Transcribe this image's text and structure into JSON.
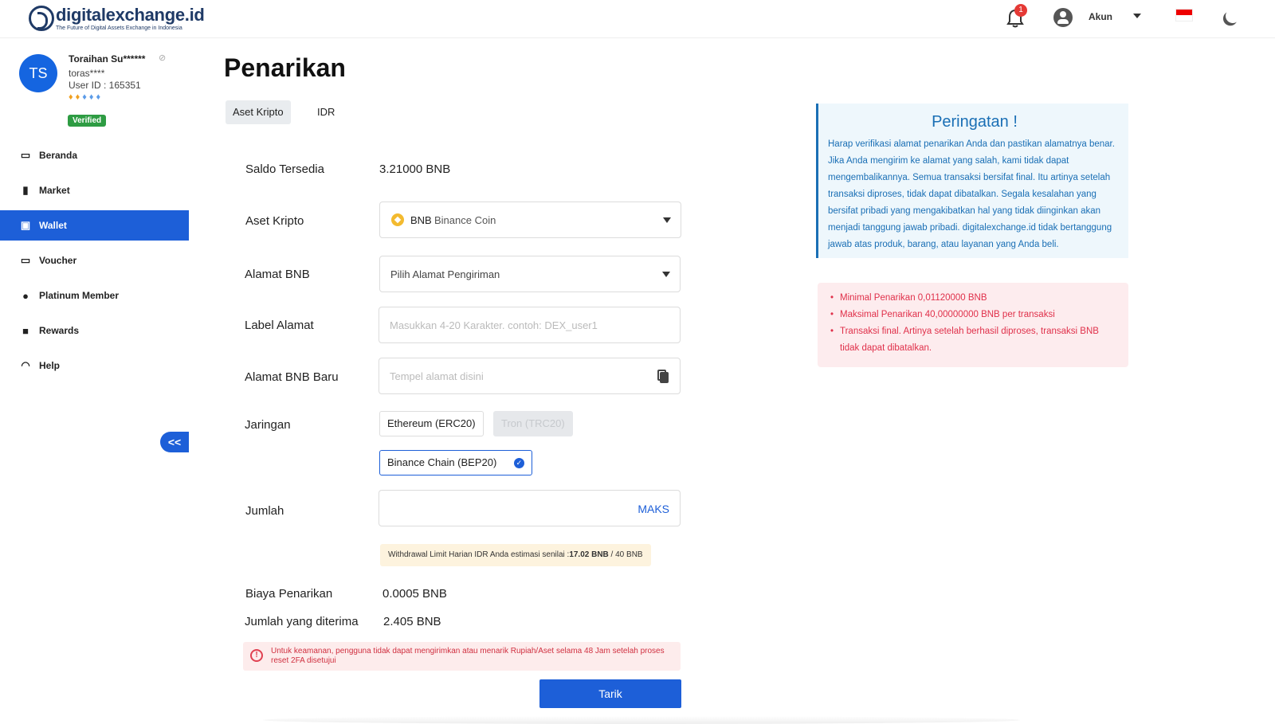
{
  "header": {
    "logo_name": "digitalexchange.id",
    "logo_tagline": "The Future of Digital Assets Exchange in Indonesia",
    "notification_count": "1",
    "account_label": "Akun"
  },
  "sidebar": {
    "avatar_initials": "TS",
    "user_name": "Toraihan Su******",
    "user_handle": "toras****",
    "user_id": "User ID : 165351",
    "verified_label": "Verified",
    "collapse_label": "<<",
    "items": [
      {
        "label": "Beranda",
        "icon": "laptop-icon"
      },
      {
        "label": "Market",
        "icon": "bar-chart-icon"
      },
      {
        "label": "Wallet",
        "icon": "wallet-icon",
        "active": true
      },
      {
        "label": "Voucher",
        "icon": "ticket-icon"
      },
      {
        "label": "Platinum Member",
        "icon": "badge-check-icon"
      },
      {
        "label": "Rewards",
        "icon": "gift-icon"
      },
      {
        "label": "Help",
        "icon": "headset-icon"
      }
    ]
  },
  "main": {
    "title": "Penarikan",
    "tabs": [
      {
        "label": "Aset Kripto",
        "active": true
      },
      {
        "label": "IDR"
      }
    ],
    "saldo": {
      "label": "Saldo Tersedia",
      "value": "3.21000 BNB"
    },
    "aset": {
      "label": "Aset Kripto",
      "symbol": "BNB",
      "name": "Binance Coin"
    },
    "alamat": {
      "label": "Alamat BNB",
      "value": "Pilih Alamat Pengiriman"
    },
    "label_alamat": {
      "label": "Label Alamat",
      "placeholder": "Masukkan 4-20 Karakter. contoh: DEX_user1"
    },
    "alamat_baru": {
      "label": "Alamat BNB Baru",
      "placeholder": "Tempel alamat disini"
    },
    "jaringan": {
      "label": "Jaringan",
      "options": [
        {
          "label": "Ethereum (ERC20)",
          "state": "enabled"
        },
        {
          "label": "Tron (TRC20)",
          "state": "disabled"
        },
        {
          "label": "Binance Chain (BEP20)",
          "state": "selected"
        }
      ]
    },
    "jumlah": {
      "label": "Jumlah",
      "max_label": "MAKS"
    },
    "limit": {
      "prefix": "Withdrawal Limit Harian IDR Anda estimasi senilai  :",
      "used": "17.02 BNB",
      "total": " / 40 BNB"
    },
    "biaya": {
      "label": "Biaya Penarikan",
      "value": "0.0005 BNB"
    },
    "diterima": {
      "label": "Jumlah yang diterima",
      "value": "2.405 BNB"
    },
    "security_note": "Untuk keamanan, pengguna tidak dapat mengirimkan atau menarik Rupiah/Aset selama 48 Jam setelah proses reset 2FA disetujui",
    "submit_label": "Tarik"
  },
  "warning": {
    "title": "Peringatan !",
    "text": "Harap verifikasi alamat penarikan Anda dan pastikan alamatnya benar. Jika Anda mengirim ke alamat yang salah, kami tidak dapat mengembalikannya. Semua transaksi bersifat final. Itu artinya setelah transaksi diproses, tidak dapat dibatalkan. Segala kesalahan yang bersifat pribadi yang mengakibatkan hal yang tidak diinginkan akan menjadi tanggung jawab pribadi. digitalexchange.id tidak bertanggung jawab atas produk, barang, atau layanan yang Anda beli."
  },
  "rules": [
    "Minimal Penarikan 0,01120000 BNB",
    "Maksimal Penarikan 40,00000000 BNB per transaksi",
    "Transaksi final. Artinya setelah berhasil diproses, transaksi BNB tidak dapat dibatalkan."
  ],
  "colors": {
    "primary": "#1d5fd8",
    "warning_text": "#1a6fb5",
    "danger": "#e0304a",
    "verified": "#2e9c43"
  }
}
